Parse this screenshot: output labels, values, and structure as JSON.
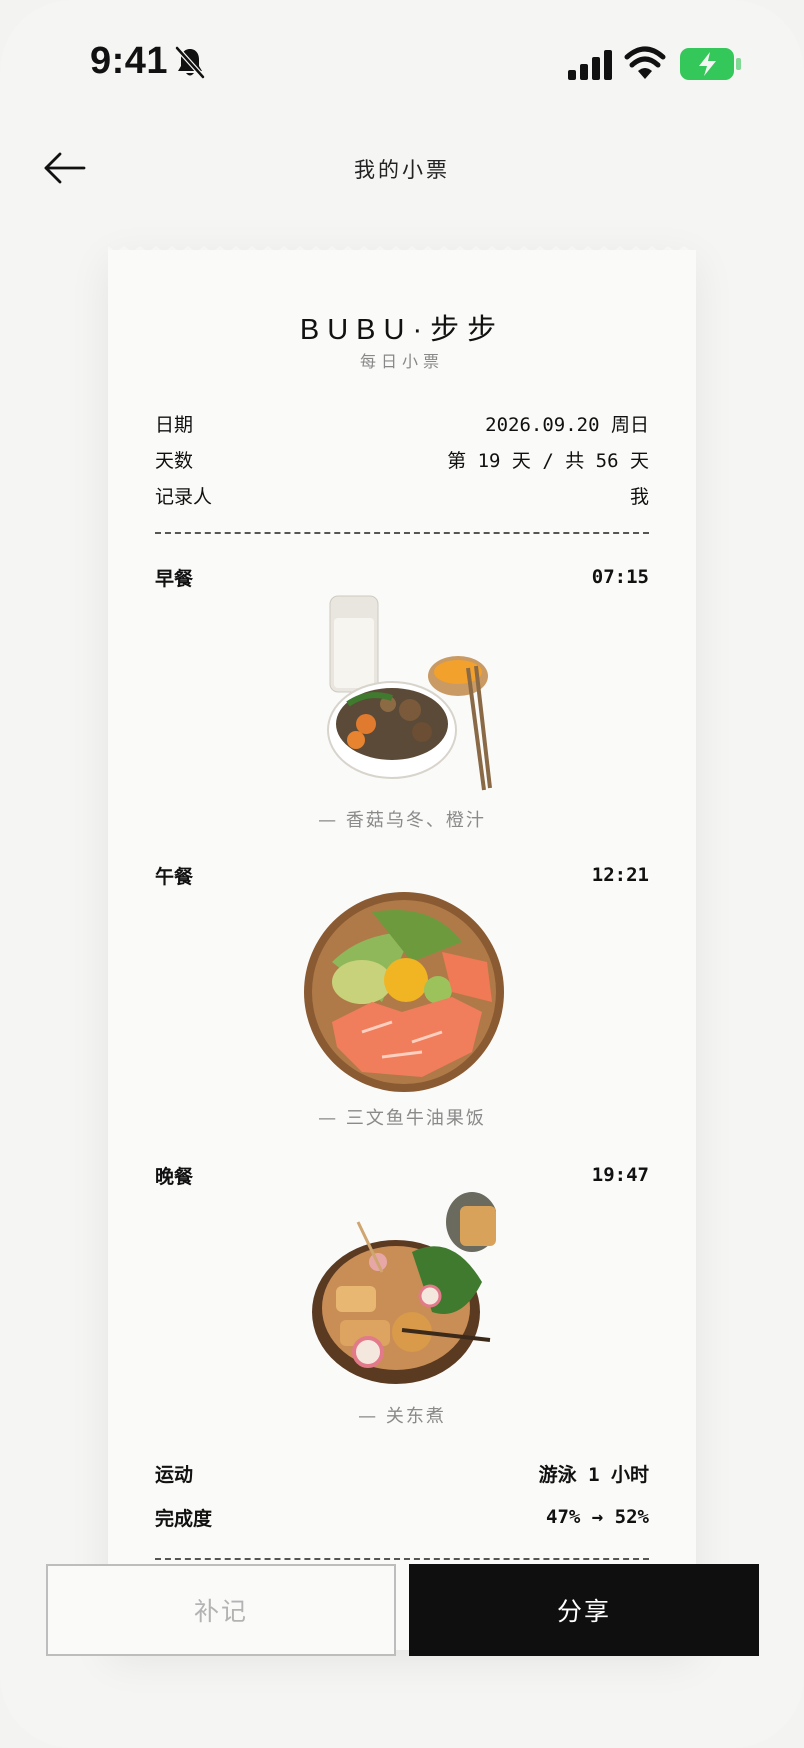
{
  "status_bar": {
    "time": "9:41",
    "icons": [
      "bell-slash-icon",
      "cellular-signal-icon",
      "wifi-icon",
      "battery-charging-icon"
    ],
    "battery_color": "#34c759"
  },
  "header": {
    "back_icon": "arrow-left-icon",
    "title": "我的小票"
  },
  "receipt": {
    "brand": "BUBU·步步",
    "subtitle": "每日小票",
    "info": [
      {
        "label": "日期",
        "value": "2026.09.20 周日"
      },
      {
        "label": "天数",
        "value": "第 19 天 / 共 56 天"
      },
      {
        "label": "记录人",
        "value": "我"
      }
    ],
    "meals": [
      {
        "name": "早餐",
        "time": "07:15",
        "caption": "— 香菇乌冬、橙汁"
      },
      {
        "name": "午餐",
        "time": "12:21",
        "caption": "— 三文鱼牛油果饭"
      },
      {
        "name": "晚餐",
        "time": "19:47",
        "caption": "— 关东煮"
      }
    ],
    "summary": [
      {
        "label": "运动",
        "value": "游泳 1 小时"
      },
      {
        "label": "完成度",
        "value": "47% → 52%"
      }
    ]
  },
  "actions": {
    "backfill_label": "补记",
    "share_label": "分享"
  },
  "colors": {
    "background": "#f5f5f3",
    "receipt": "#fafaf8",
    "primary_button": "#0f0f0f",
    "muted_text": "#8a8a8a"
  }
}
